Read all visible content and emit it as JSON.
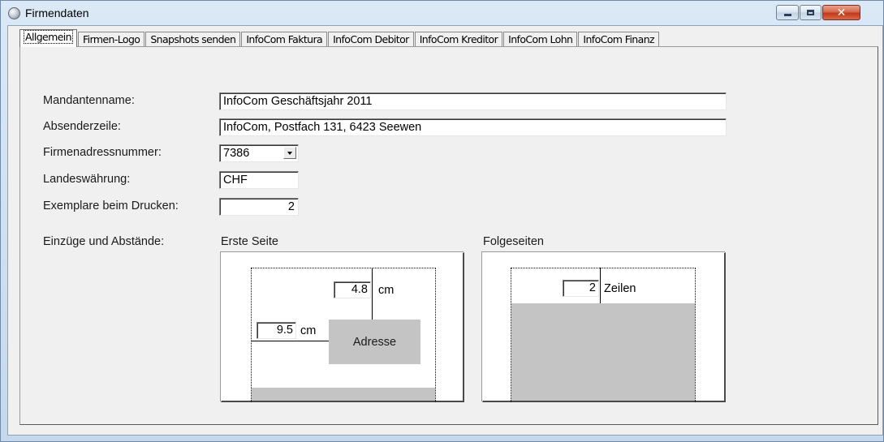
{
  "window": {
    "title": "Firmendaten"
  },
  "tabs": [
    {
      "label": "Allgemein",
      "active": true
    },
    {
      "label": "Firmen-Logo"
    },
    {
      "label": "Snapshots senden"
    },
    {
      "label": "InfoCom Faktura"
    },
    {
      "label": "InfoCom Debitor"
    },
    {
      "label": "InfoCom Kreditor"
    },
    {
      "label": "InfoCom Lohn"
    },
    {
      "label": "InfoCom Finanz"
    }
  ],
  "form": {
    "mandantenname": {
      "label": "Mandantenname:",
      "value": "InfoCom Geschäftsjahr 2011"
    },
    "absenderzeile": {
      "label": "Absenderzeile:",
      "value": "InfoCom, Postfach 131, 6423 Seewen"
    },
    "firmenadressnummer": {
      "label": "Firmenadressnummer:",
      "value": "7386"
    },
    "landeswaehrung": {
      "label": "Landeswährung:",
      "value": "CHF"
    },
    "exemplare": {
      "label": "Exemplare beim Drucken:",
      "value": "2"
    }
  },
  "einzuege": {
    "label": "Einzüge und Abstände:",
    "erste_seite": {
      "title": "Erste Seite",
      "top_value": "4.8",
      "top_unit": "cm",
      "left_value": "9.5",
      "left_unit": "cm",
      "address_label": "Adresse"
    },
    "folgeseiten": {
      "title": "Folgeseiten",
      "lines_value": "2",
      "lines_unit": "Zeilen"
    }
  },
  "colors": {
    "window_frame": "#cfe0f1",
    "dialog_bg": "#f0f0f0",
    "preview_gray": "#c4c4c4",
    "close_button": "#c2381c"
  }
}
